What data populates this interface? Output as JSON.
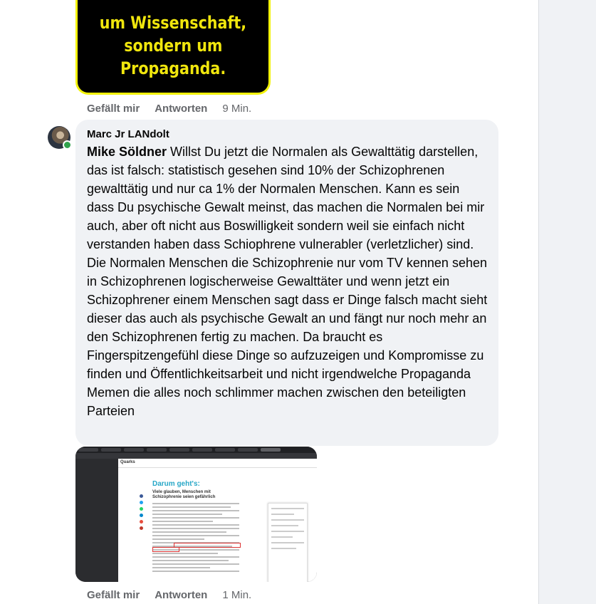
{
  "meme": {
    "lines": [
      "um Wissenschaft,",
      "sondern um",
      "Propaganda."
    ]
  },
  "comment1_actions": {
    "like": "Gefällt mir",
    "reply": "Antworten",
    "time": "9 Min."
  },
  "comment2": {
    "author": "Marc Jr LANdolt",
    "mention": "Mike Söldner",
    "text": " Willst Du jetzt die Normalen als Gewalttätig darstellen, das ist falsch: statistisch gesehen sind 10% der Schizophrenen gewalttätig und nur ca 1% der Normalen Menschen. Kann es sein dass Du psychische Gewalt meinst, das machen die Normalen bei mir auch, aber oft nicht aus Boswilligkeit sondern weil sie einfach nicht verstanden haben dass Schiophrene vulnerabler (verletzlicher) sind. Die Normalen Menschen die Schizophrenie nur vom TV kennen sehen in Schizophrenen logischerweise Gewalttäter und wenn jetzt ein Schizophrener einem Menschen sagt dass er Dinge falsch macht sieht dieser das auch als psychische Gewalt an und fängt nur noch mehr an den Schizophrenen fertig zu machen. Da braucht es Fingerspitzengefühl diese Dinge so aufzuzeigen und Kompromisse zu finden und Öffentlichkeitsarbeit und nicht irgendwelche Propaganda Memen die alles noch schlimmer machen zwischen den beteiligten Parteien"
  },
  "screenshot": {
    "logo": "Quarks",
    "heading": "Darum geht's:",
    "subheading": "Viele glauben, Menschen mit Schizophrenie seien gefährlich"
  },
  "comment2_actions": {
    "like": "Gefällt mir",
    "reply": "Antworten",
    "time": "1 Min."
  },
  "colors": {
    "bubble": "#f0f2f5",
    "meme_border": "#f2f20a",
    "meme_text": "#f0e60d",
    "meta_text": "#65676b",
    "online": "#31a24c"
  }
}
